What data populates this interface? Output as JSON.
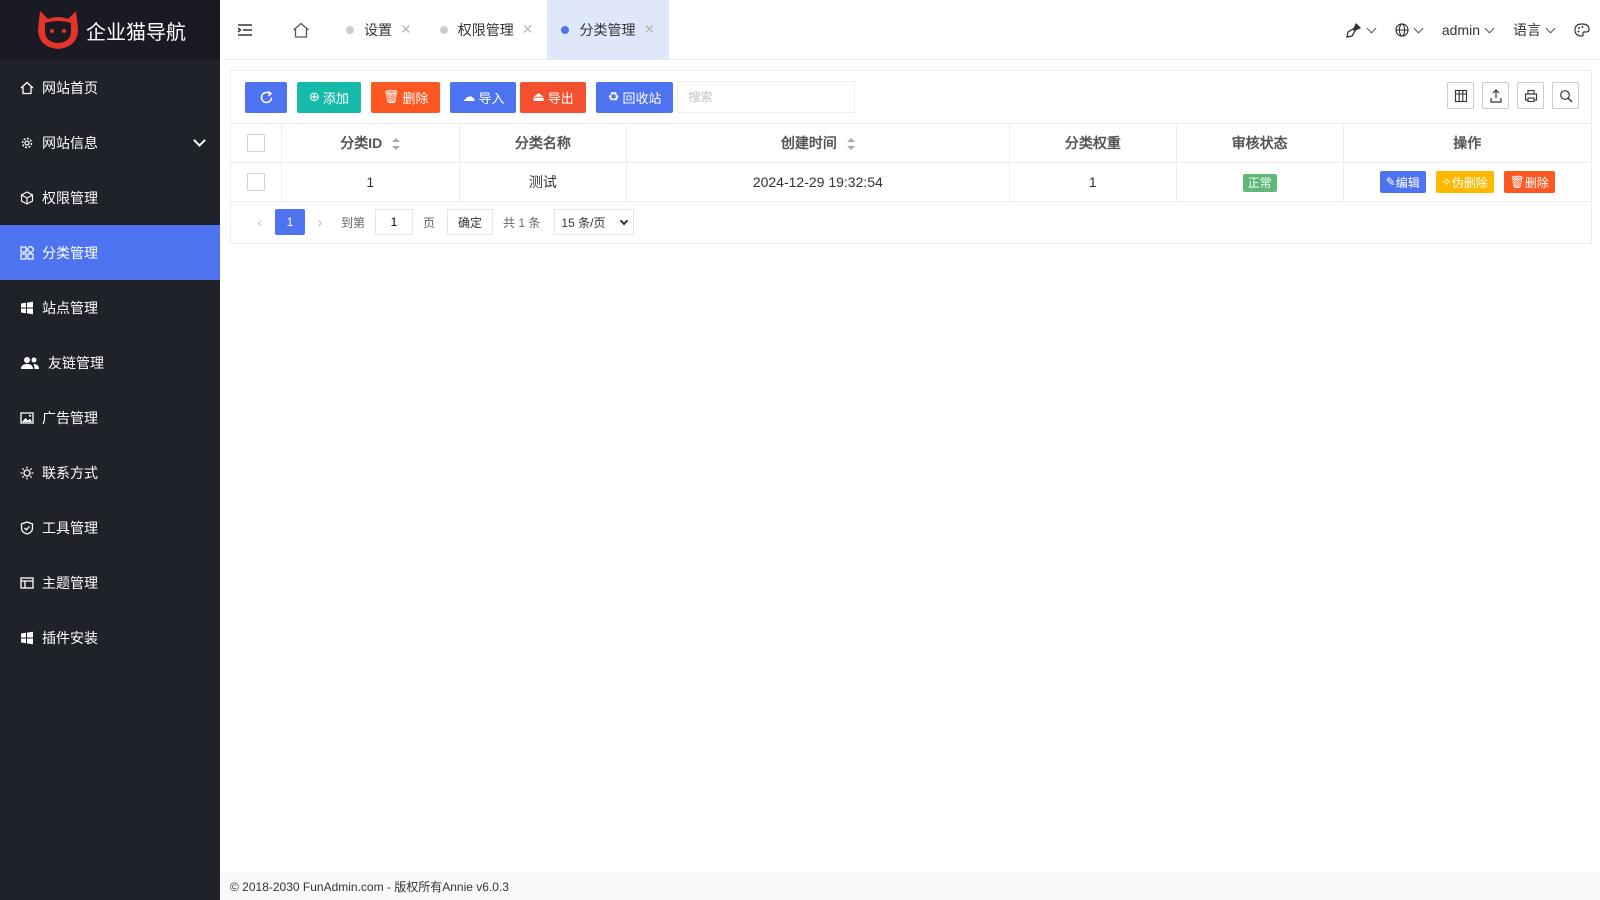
{
  "app": {
    "title": "企业猫导航"
  },
  "sidebar": {
    "items": [
      {
        "label": "网站首页",
        "icon": "home-icon"
      },
      {
        "label": "网站信息",
        "icon": "gear-icon",
        "expandable": true
      },
      {
        "label": "权限管理",
        "icon": "cube-icon"
      },
      {
        "label": "分类管理",
        "icon": "grid-icon",
        "active": true
      },
      {
        "label": "站点管理",
        "icon": "windows-icon"
      },
      {
        "label": "友链管理",
        "icon": "users-icon"
      },
      {
        "label": "广告管理",
        "icon": "image-icon"
      },
      {
        "label": "联系方式",
        "icon": "sun-icon"
      },
      {
        "label": "工具管理",
        "icon": "shield-icon"
      },
      {
        "label": "主题管理",
        "icon": "layout-icon"
      },
      {
        "label": "插件安装",
        "icon": "windows-icon"
      }
    ]
  },
  "header": {
    "tabs": [
      {
        "label": "设置"
      },
      {
        "label": "权限管理"
      },
      {
        "label": "分类管理",
        "active": true
      }
    ],
    "user": "admin",
    "language": "语言"
  },
  "toolbar": {
    "add": "添加",
    "delete": "删除",
    "import": "导入",
    "export": "导出",
    "recycle": "回收站",
    "search_placeholder": "搜索"
  },
  "table": {
    "headers": [
      "分类ID",
      "分类名称",
      "创建时间",
      "分类权重",
      "审核状态",
      "操作"
    ],
    "rows": [
      {
        "id": "1",
        "name": "测试",
        "created": "2024-12-29 19:32:54",
        "weight": "1",
        "status": "正常"
      }
    ],
    "actions": {
      "edit": "编辑",
      "soft_delete": "伪删除",
      "delete": "删除"
    }
  },
  "pager": {
    "current": "1",
    "goto_label": "到第",
    "goto_value": "1",
    "page_unit": "页",
    "confirm": "确定",
    "total": "共 1 条",
    "page_size": "15 条/页"
  },
  "footer": {
    "text": "© 2018-2030 FunAdmin.com - 版权所有Annie v6.0.3"
  },
  "colors": {
    "sidebar": "#20222a",
    "accent": "#4e73f0",
    "green": "#16baaa",
    "orange": "#ff5722",
    "status_ok": "#5fb878"
  }
}
